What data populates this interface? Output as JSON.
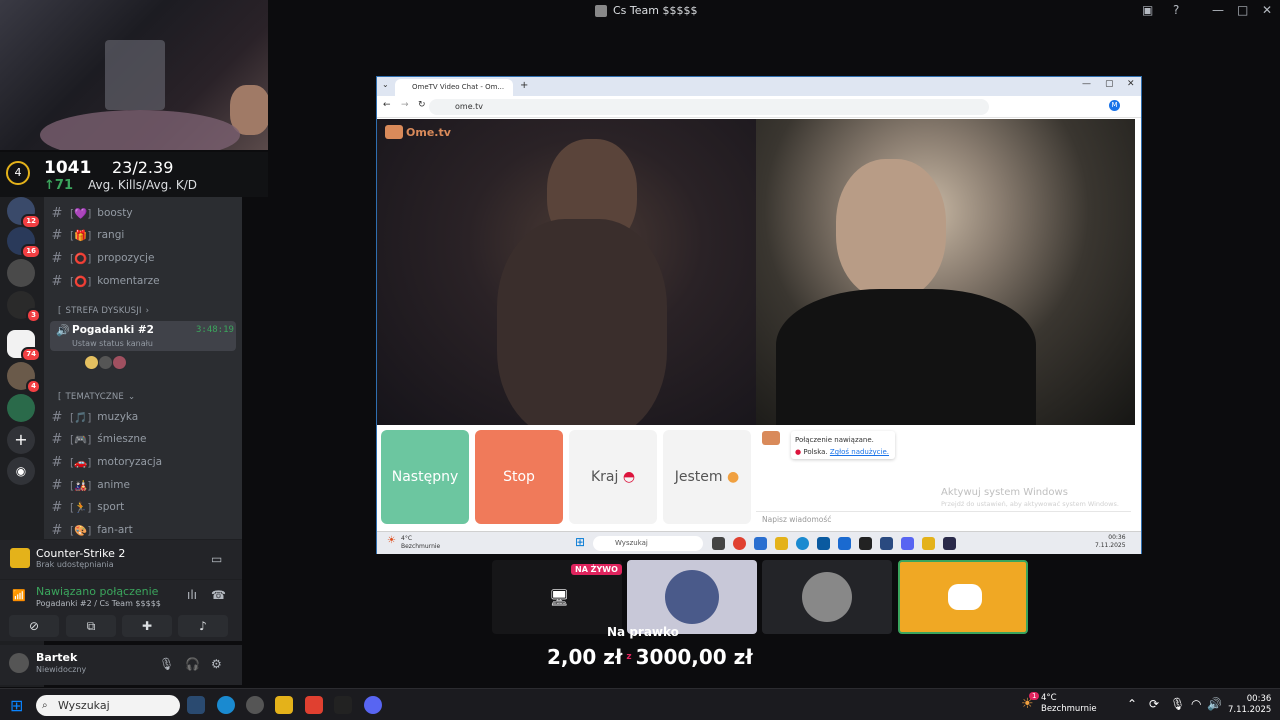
{
  "titlebar": {
    "title": "Cs Team $$$$$"
  },
  "stats": {
    "level": "4",
    "elo": "1041",
    "elo_gain": "↑71",
    "kills_kd": "23/2.39",
    "kd_label": "Avg. Kills/Avg. K/D"
  },
  "servers": [
    {
      "badge": "12"
    },
    {
      "badge": "16"
    },
    {
      "badge": ""
    },
    {
      "badge": "3"
    },
    {
      "badge": "74"
    },
    {
      "badge": "4"
    },
    {
      "badge": ""
    }
  ],
  "channels": [
    {
      "icon": "💜",
      "name": "boosty"
    },
    {
      "icon": "🎁",
      "name": "rangi"
    },
    {
      "icon": "⭕",
      "name": "propozycje"
    },
    {
      "icon": "⭕",
      "name": "komentarze"
    }
  ],
  "categories": {
    "strefa": "STREFA DYSKUSJI",
    "tematyczne": "TEMATYCZNE"
  },
  "voice": {
    "name": "Pogadanki #2",
    "time": "3:48:19",
    "status": "Ustaw status kanału"
  },
  "channels2": [
    {
      "icon": "🎵",
      "name": "muzyka"
    },
    {
      "icon": "🎮",
      "name": "śmieszne"
    },
    {
      "icon": "🚗",
      "name": "motoryzacja"
    },
    {
      "icon": "🎎",
      "name": "anime"
    },
    {
      "icon": "🏃",
      "name": "sport"
    },
    {
      "icon": "🎨",
      "name": "fan-art"
    }
  ],
  "activity": {
    "game": "Counter-Strike 2",
    "status": "Brak udostępniania"
  },
  "connection": {
    "status": "Nawiązano połączenie",
    "channel": "Pogadanki #2 / Cs Team $$$$$"
  },
  "user": {
    "name": "Bartek",
    "status": "Niewidoczny"
  },
  "browser": {
    "tab_title": "OmeTV Video Chat - Om...",
    "url": "ome.tv",
    "logo": "Ome.tv",
    "buttons": {
      "next": "Następny",
      "stop": "Stop",
      "country": "Kraj",
      "gender": "Jestem"
    },
    "chat": {
      "connected": "Połączenie nawiązane.",
      "country": "Polska.",
      "report": "Zgłoś nadużycie.",
      "watermark": "Aktywuj system Windows",
      "watermark_sub": "Przejdź do ustawień, aby aktywować system Windows.",
      "placeholder": "Napisz wiadomość"
    },
    "taskbar": {
      "weather_temp": "4°C",
      "weather_desc": "Bezchmurnie",
      "search": "Wyszukaj",
      "time": "00:36",
      "date": "7.11.2025"
    }
  },
  "stream": {
    "live_badge": "NA ŻYWO",
    "nav_label": "Na prawko",
    "amount_current": "2,00 zł",
    "amount_sep": "z",
    "amount_goal": "3000,00 zł"
  },
  "taskbar": {
    "search": "Wyszukaj",
    "weather_temp": "4°C",
    "weather_desc": "Bezchmurnie",
    "time": "00:36",
    "date": "7.11.2025",
    "weather_badge": "1"
  },
  "colors": {
    "green": "#3ba55d",
    "next_btn": "#6cc6a0",
    "stop_btn": "#f07a5a",
    "discord_tile": "#f0a824"
  }
}
